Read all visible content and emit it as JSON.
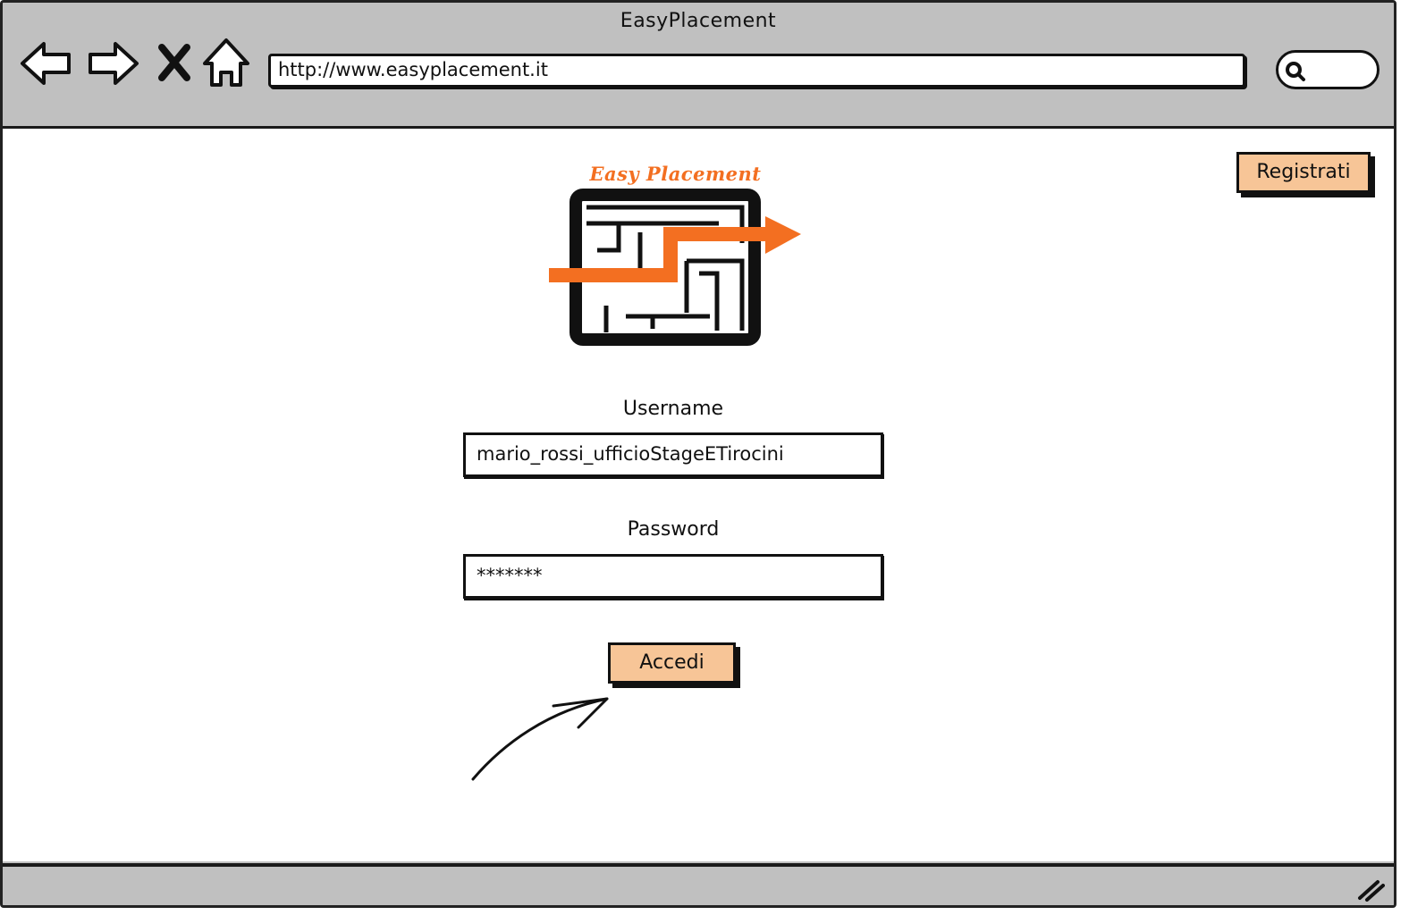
{
  "window": {
    "title": "EasyPlacement",
    "url": "http://www.easyplacement.it"
  },
  "nav": {
    "back_icon": "back-arrow-icon",
    "forward_icon": "forward-arrow-icon",
    "stop_icon": "close-icon",
    "home_icon": "home-icon",
    "search_icon": "search-icon"
  },
  "header": {
    "register_label": "Registrati"
  },
  "logo": {
    "text": "Easy Placement"
  },
  "login_form": {
    "username_label": "Username",
    "username_value": "mario_rossi_ufficioStageETirocini",
    "password_label": "Password",
    "password_value": "*******",
    "submit_label": "Accedi"
  },
  "colors": {
    "button_fill": "#f7c597",
    "logo_orange": "#f36f21",
    "chrome_gray": "#c0c0c0"
  }
}
